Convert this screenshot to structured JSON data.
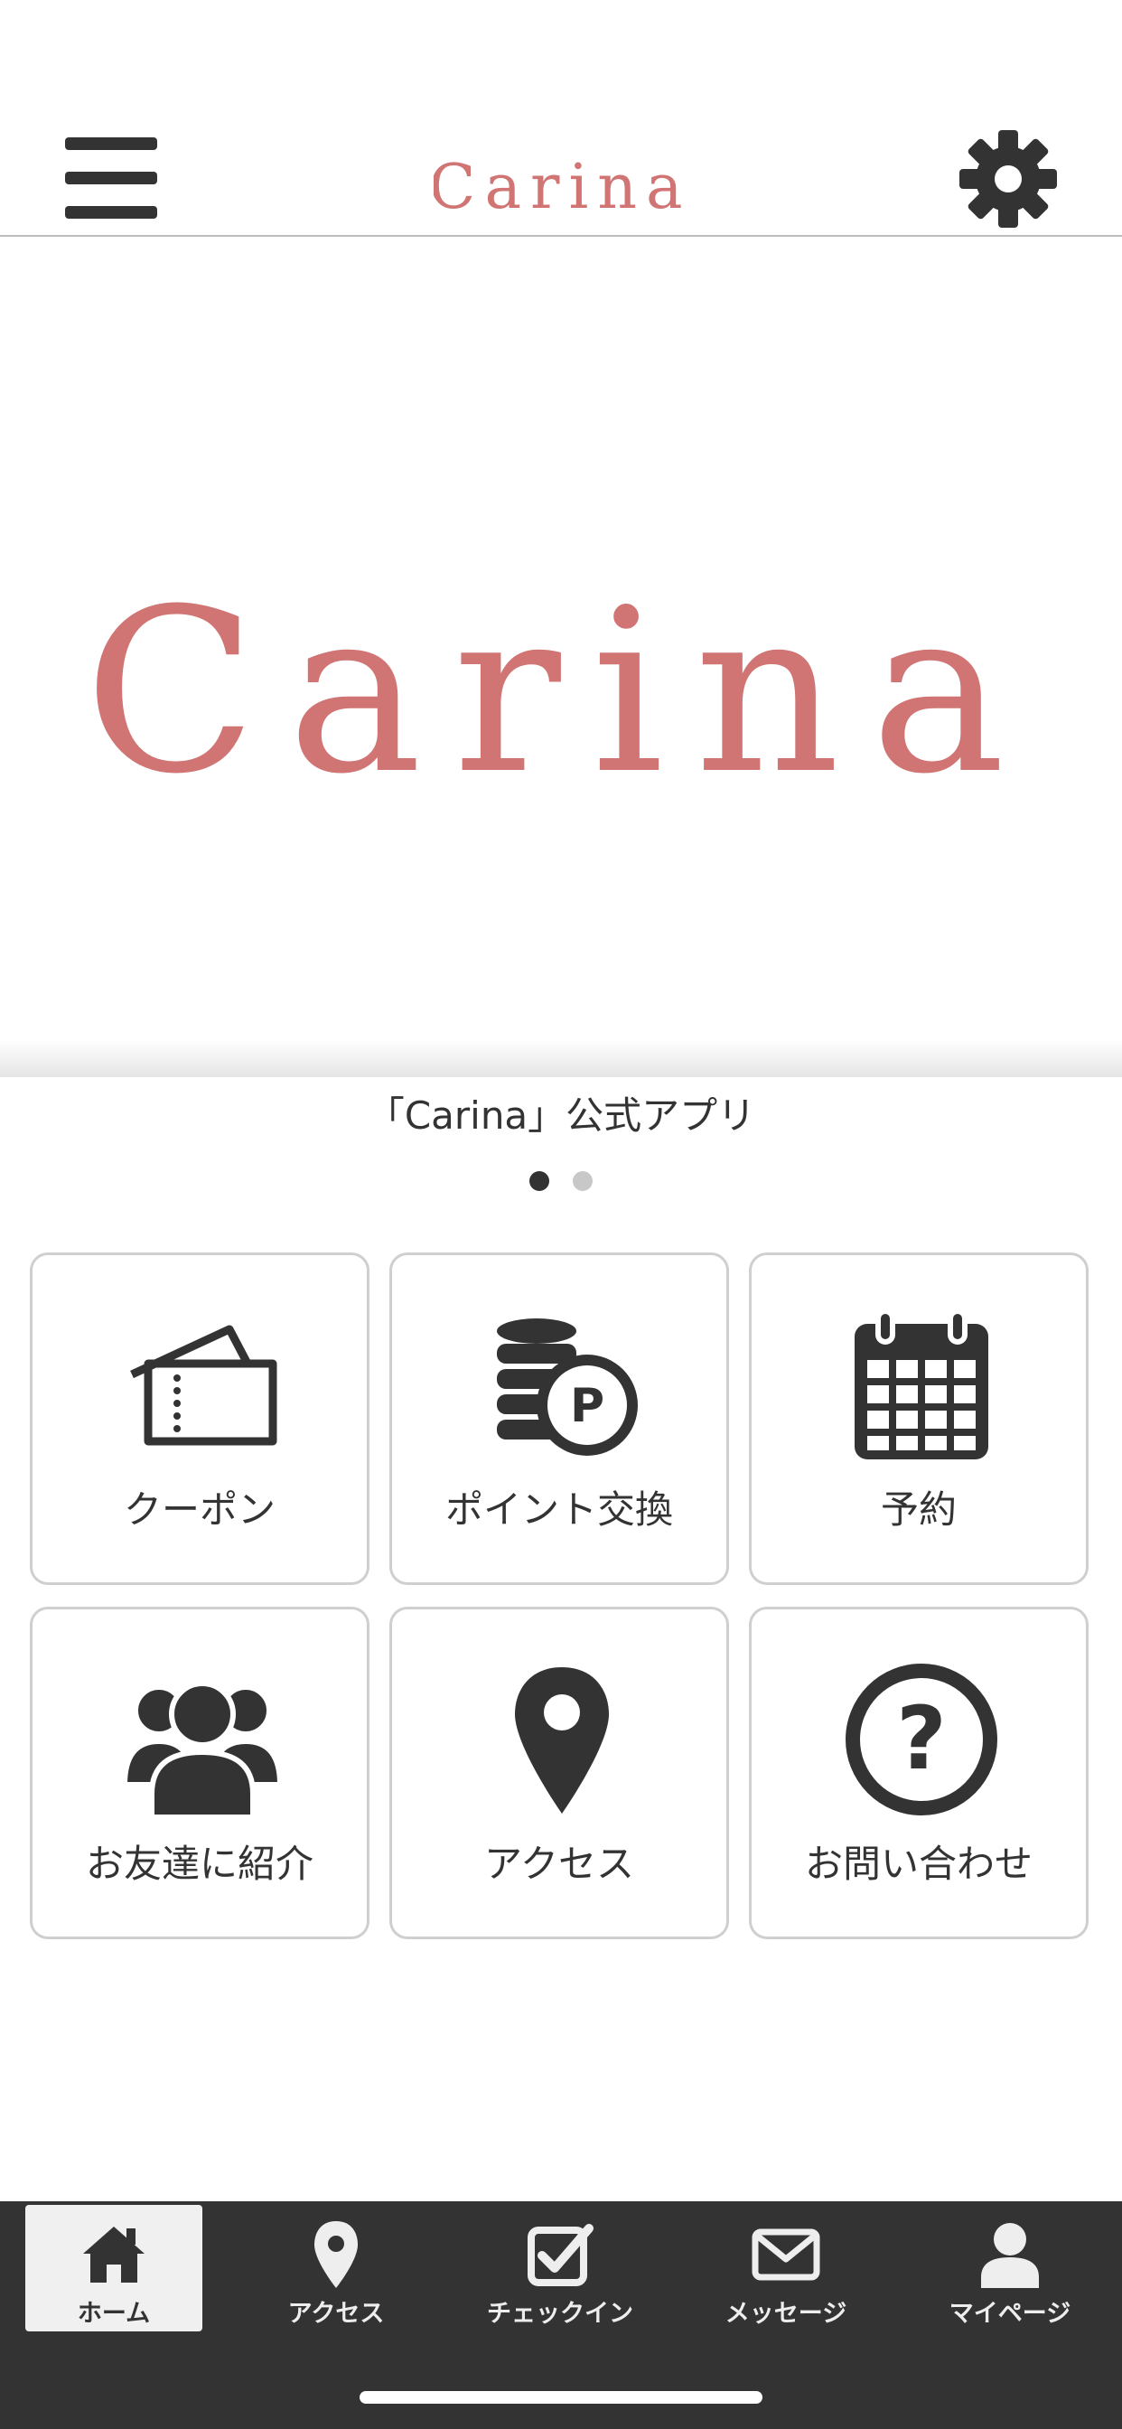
{
  "header": {
    "logo_text": "Carina",
    "menu_icon": "hamburger-icon",
    "settings_icon": "gear-icon"
  },
  "hero": {
    "logo_text": "Carina",
    "brand_color": "#d07474"
  },
  "carousel": {
    "caption": "「Carina」公式アプリ",
    "page_count": 2,
    "active_page": 1
  },
  "menu_tiles": [
    {
      "label": "クーポン",
      "icon": "ticket-icon"
    },
    {
      "label": "ポイント交換",
      "icon": "coins-point-icon"
    },
    {
      "label": "予約",
      "icon": "calendar-icon"
    },
    {
      "label": "お友達に紹介",
      "icon": "users-icon"
    },
    {
      "label": "アクセス",
      "icon": "map-pin-icon"
    },
    {
      "label": "お問い合わせ",
      "icon": "question-circle-icon"
    }
  ],
  "tabbar": {
    "items": [
      {
        "label": "ホーム",
        "icon": "home-icon",
        "active": true
      },
      {
        "label": "アクセス",
        "icon": "map-pin-icon",
        "active": false
      },
      {
        "label": "チェックイン",
        "icon": "checkbox-icon",
        "active": false
      },
      {
        "label": "メッセージ",
        "icon": "envelope-icon",
        "active": false
      },
      {
        "label": "マイページ",
        "icon": "user-icon",
        "active": false
      }
    ]
  },
  "colors": {
    "brand": "#d07474",
    "icon_dark": "#333333",
    "tabbar_bg": "#333333",
    "tile_border": "#cfcfcf"
  }
}
